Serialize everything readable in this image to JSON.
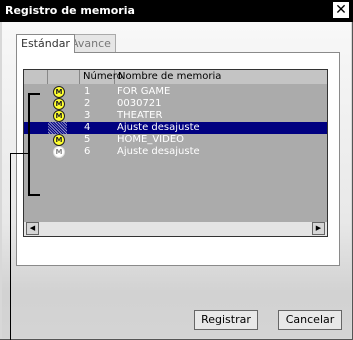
{
  "window": {
    "title": "Registro de memoria",
    "close_glyph": "✕"
  },
  "tabs": [
    {
      "label": "Estándar",
      "active": true
    },
    {
      "label": "Avance",
      "active": false
    }
  ],
  "list": {
    "columns": [
      "",
      "",
      "Número",
      "Nombre de memoria"
    ],
    "rows": [
      {
        "icon": "memory-m-icon",
        "icon_text": "M",
        "number": "1",
        "name": "FOR GAME",
        "selected": false
      },
      {
        "icon": "memory-m-icon",
        "icon_text": "M",
        "number": "2",
        "name": "0030721",
        "selected": false
      },
      {
        "icon": "memory-m-icon",
        "icon_text": "M",
        "number": "3",
        "name": "THEATER",
        "selected": false
      },
      {
        "icon": "",
        "icon_text": "",
        "number": "4",
        "name": "Ajuste desajuste",
        "selected": true
      },
      {
        "icon": "memory-m-icon",
        "icon_text": "M",
        "number": "5",
        "name": "HOME_VIDEO",
        "selected": false
      },
      {
        "icon": "memory-m-faded-icon",
        "icon_text": "M",
        "number": "6",
        "name": "Ajuste desajuste",
        "selected": false
      }
    ],
    "scroll_left": "◀",
    "scroll_right": "▶"
  },
  "buttons": {
    "register": "Registrar",
    "cancel": "Cancelar"
  },
  "colors": {
    "selection": "#000080",
    "memory_icon": "#ffff30",
    "title_bar": "#000000"
  }
}
